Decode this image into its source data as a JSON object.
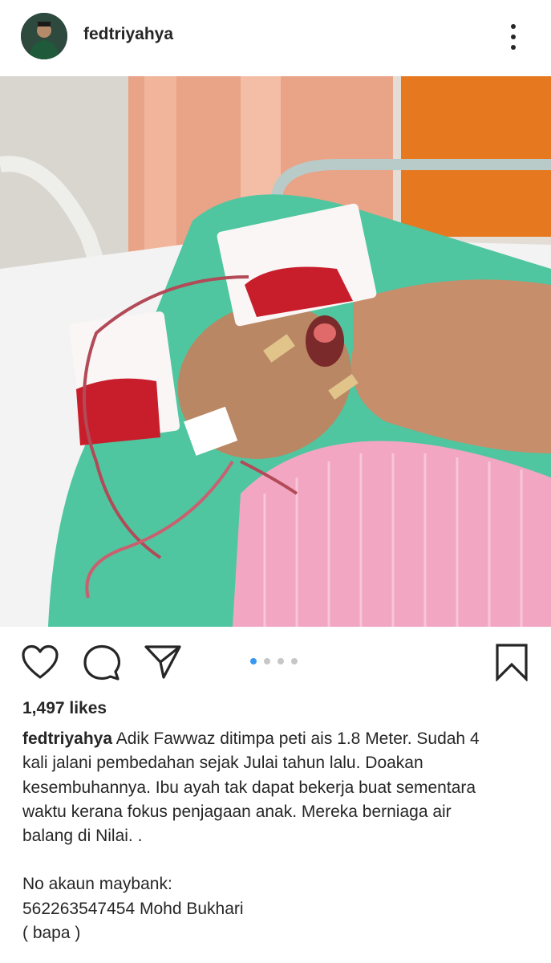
{
  "post": {
    "username": "fedtriyahya",
    "likes": "1,497 likes",
    "carousel": {
      "total": 4,
      "active_index": 0
    },
    "caption": {
      "username": "fedtriyahya",
      "lines": [
        " Adik Fawwaz ditimpa peti ais 1.8 Meter. Sudah 4",
        "kali jalani pembedahan sejak Julai tahun lalu. Doakan",
        "kesembuhannya. Ibu ayah tak dapat bekerja buat sementara",
        "waktu kerana fokus penjagaan anak. Mereka berniaga air",
        "balang di Nilai. ."
      ],
      "bank_lines": [
        "No akaun maybank:",
        "562263547454 Mohd Bukhari",
        "( bapa )"
      ]
    }
  },
  "icons": {
    "avatar": "profile-avatar",
    "more": "more-options-icon",
    "like": "heart-icon",
    "comment": "comment-bubble-icon",
    "share": "send-paper-plane-icon",
    "save": "bookmark-icon"
  },
  "colors": {
    "text": "#262626",
    "carousel_active": "#3897f0",
    "carousel_inactive": "#c7c7c7"
  }
}
